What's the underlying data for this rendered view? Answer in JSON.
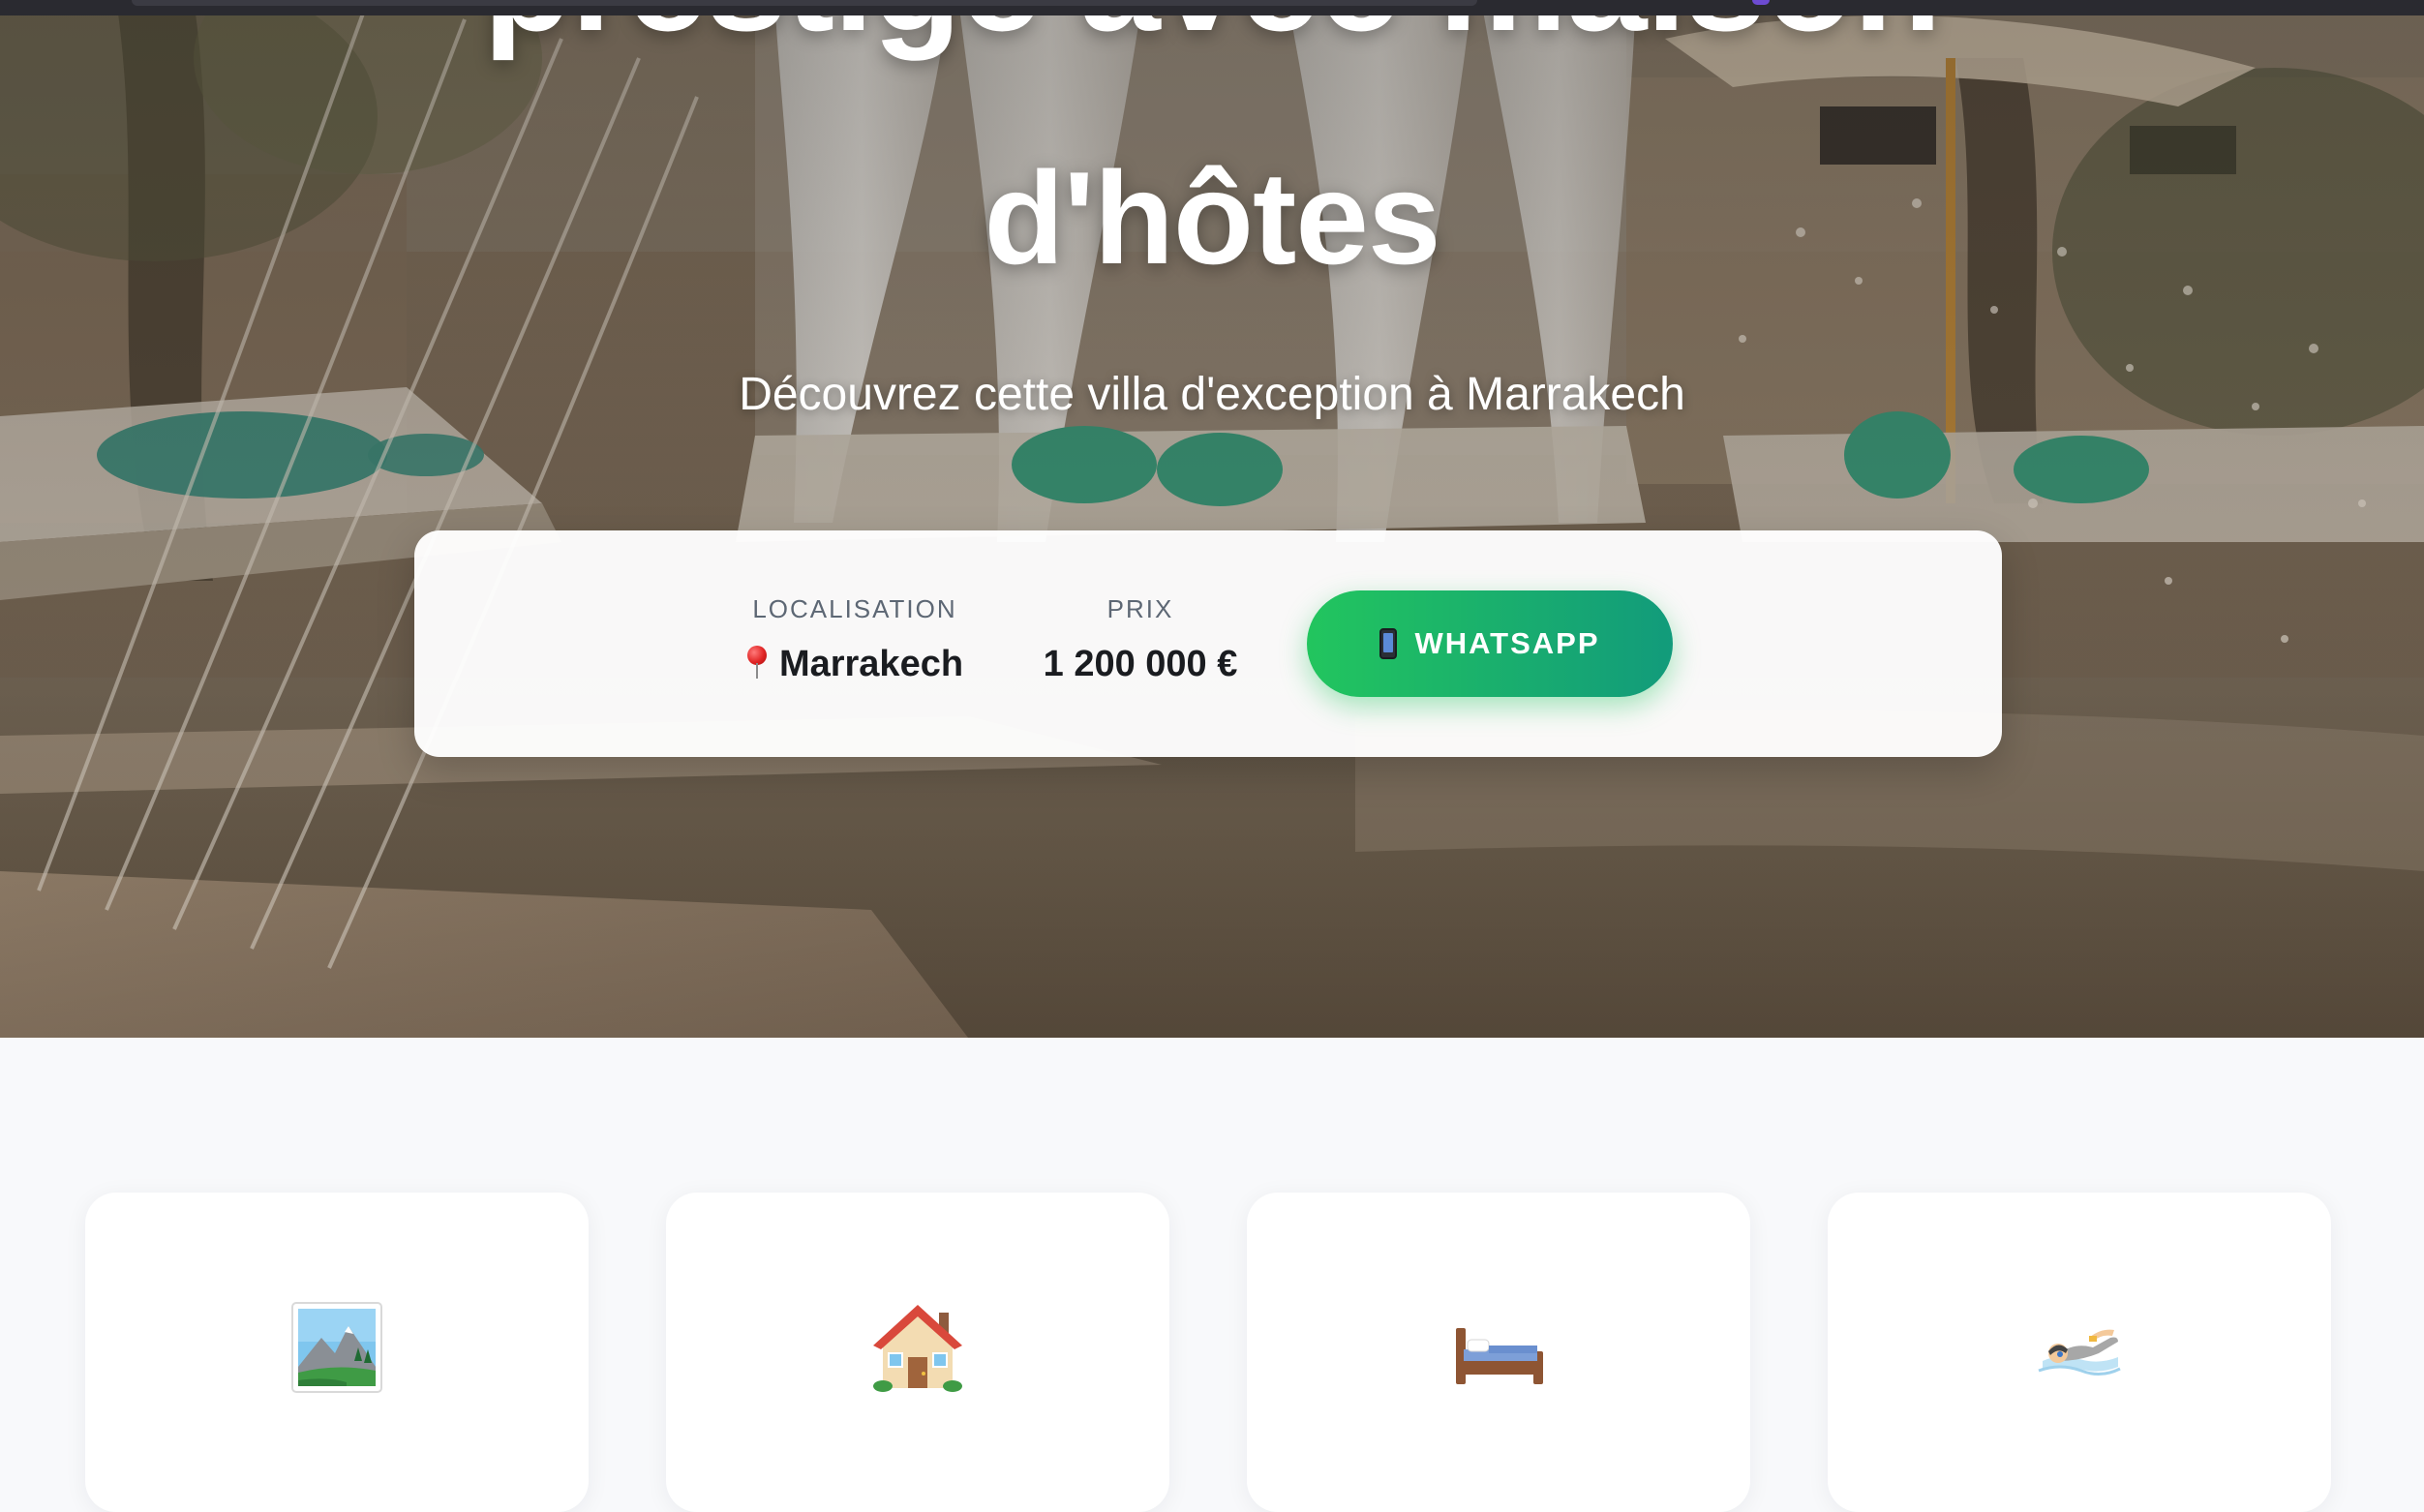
{
  "hero": {
    "title_top": "prestige avec maison",
    "title_main": "d'hôtes",
    "subtitle": "Découvrez cette villa d'exception à Marrakech"
  },
  "info_card": {
    "location": {
      "label": "LOCALISATION",
      "value": "Marrakech",
      "icon": "map-pin-icon"
    },
    "price": {
      "label": "PRIX",
      "value": "1 200 000 €"
    },
    "whatsapp_button": {
      "label": "WHATSAPP",
      "icon": "mobile-phone-icon"
    }
  },
  "features": [
    {
      "icon": "landscape-picture-icon"
    },
    {
      "icon": "house-icon"
    },
    {
      "icon": "bed-icon"
    },
    {
      "icon": "swimmer-icon"
    }
  ],
  "colors": {
    "whatsapp_gradient_start": "#22c55e",
    "whatsapp_gradient_end": "#129b7b",
    "page_background": "#f8f9fb",
    "card_background": "#ffffff",
    "label_text": "#5d6774",
    "value_text": "#1a1c20"
  }
}
